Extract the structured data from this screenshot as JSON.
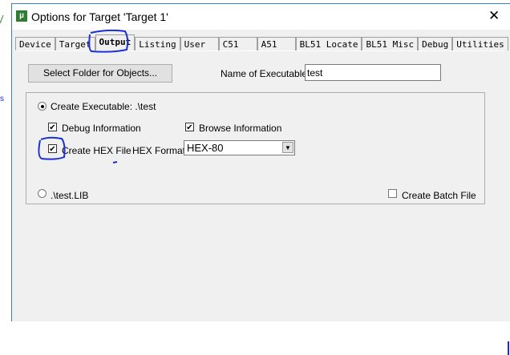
{
  "window": {
    "title": "Options for Target 'Target 1'",
    "close": "✕"
  },
  "tabs": [
    "Device",
    "Target",
    "Output",
    "Listing",
    "User",
    "C51",
    "A51",
    "BL51 Locate",
    "BL51 Misc",
    "Debug",
    "Utilities"
  ],
  "active_tab": "Output",
  "output": {
    "select_folder": "Select Folder for Objects...",
    "name_label": "Name of Executable:",
    "name_value": "test",
    "create_exe": "Create Executable:  .\\test",
    "debug_info": "Debug Information",
    "browse_info": "Browse Information",
    "create_hex": "Create HEX File",
    "hex_format_label": "HEX Format:",
    "hex_format_value": "HEX-80",
    "create_lib": ".\\test.LIB",
    "batch_file": "Create Batch File"
  },
  "checks": {
    "debug": true,
    "browse": true,
    "hex": true,
    "batch": false
  },
  "colors": {
    "annotation": "#1a2fd6",
    "panel": "#f0f0f0"
  }
}
